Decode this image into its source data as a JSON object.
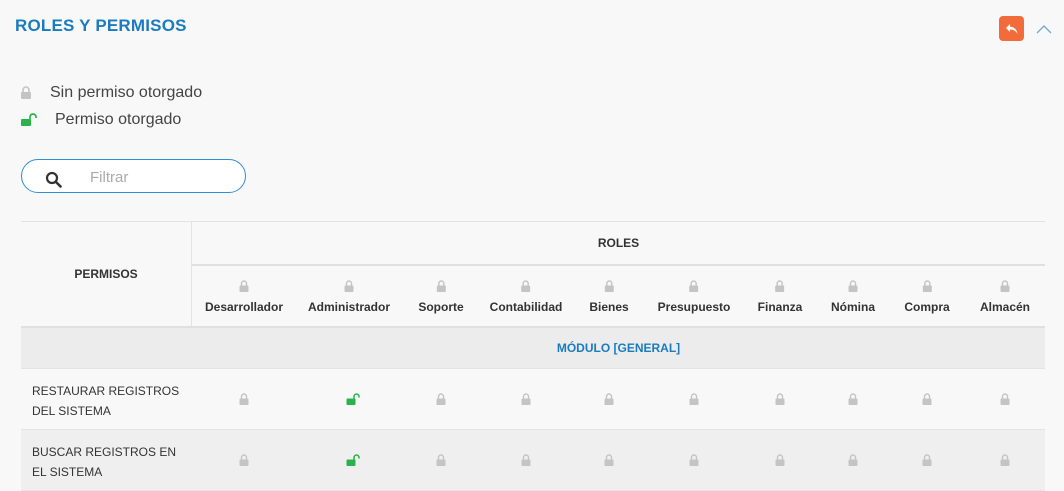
{
  "header": {
    "title": "ROLES Y PERMISOS",
    "back_icon": "reply-arrow-icon",
    "collapse_icon": "chevron-up-icon"
  },
  "legend": [
    {
      "icon": "lock-closed-icon",
      "label": "Sin permiso otorgado"
    },
    {
      "icon": "lock-open-icon",
      "label": "Permiso otorgado"
    }
  ],
  "filter": {
    "placeholder": "Filtrar",
    "value": ""
  },
  "table": {
    "permissions_header": "PERMISOS",
    "roles_header": "ROLES",
    "roles": [
      "Desarrollador",
      "Administrador",
      "Soporte",
      "Contabilidad",
      "Bienes",
      "Presupuesto",
      "Finanza",
      "Nómina",
      "Compra",
      "Almacén"
    ],
    "module_label": "MÓDULO [GENERAL]",
    "rows": [
      {
        "name": "RESTAURAR REGISTROS DEL SISTEMA",
        "granted": [
          false,
          true,
          false,
          false,
          false,
          false,
          false,
          false,
          false,
          false
        ]
      },
      {
        "name": "BUSCAR REGISTROS EN EL SISTEMA",
        "granted": [
          false,
          true,
          false,
          false,
          false,
          false,
          false,
          false,
          false,
          false
        ]
      }
    ]
  },
  "colors": {
    "accent_blue": "#1a7bbf",
    "granted_green": "#2ab24b",
    "denied_gray": "#c4c4c4",
    "back_button_orange": "#f26b3a"
  }
}
